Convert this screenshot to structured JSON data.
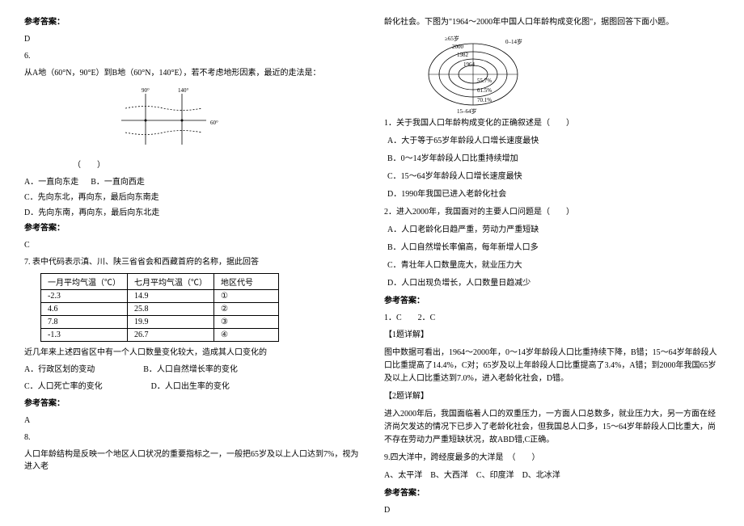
{
  "left": {
    "ans_label_1": "参考答案：",
    "ans_1": "D",
    "q6_num": "6.",
    "q6_text": "从A地（60°N，90°E）到B地（60°N，140°E），若不考虑地形因素，最近的走法是：",
    "q6_paren": "（　　）",
    "q6_optA": "A．一直向东走",
    "q6_optB": "B．一直向西走",
    "q6_optC": "C．先向东北，再向东，最后向东南走",
    "q6_optD": "D．先向东南，再向东，最后向东北走",
    "ans_label_2": "参考答案：",
    "ans_2": "C",
    "q7_text": "7. 表中代码表示滇、川、陕三省省会和西藏首府的名称，据此回答",
    "table": {
      "h1": "一月平均气温（℃）",
      "h2": "七月平均气温（℃）",
      "h3": "地区代号",
      "r1c1": "-2.3",
      "r1c2": "14.9",
      "r1c3": "①",
      "r2c1": "4.6",
      "r2c2": "25.8",
      "r2c3": "②",
      "r3c1": "7.8",
      "r3c2": "19.9",
      "r3c3": "③",
      "r4c1": "-1.3",
      "r4c2": "26.7",
      "r4c3": "④"
    },
    "q7_sub": "近几年来上述四省区中有一个人口数量变化较大，造成其人口变化的",
    "q7_optA": "A．行政区划的变动",
    "q7_optB": "B．人口自然增长率的变化",
    "q7_optC": "C．人口死亡率的变化",
    "q7_optD": "D．人口出生率的变化",
    "ans_label_3": "参考答案：",
    "ans_3": "A",
    "q8_num": "8.",
    "q8_text": "人口年龄结构是反映一个地区人口状况的重要指标之一，一般把65岁及以上人口达到7%，视为进入老"
  },
  "right": {
    "q8_cont": "龄化社会。下图为\"1964～2000年中国人口年龄构成变化图\"，据图回答下面小题。",
    "q8_1": "1．关于我国人口年龄构成变化的正确叙述是（　　）",
    "q8_1A": "A．大于等于65岁年龄段人口增长速度最快",
    "q8_1B": "B．0～14岁年龄段人口比重持续增加",
    "q8_1C": "C．15～64岁年龄段人口增长速度最快",
    "q8_1D": "D．1990年我国已进入老龄化社会",
    "q8_2": "2．进入2000年，我国面对的主要人口问题是（　　）",
    "q8_2A": "A．人口老龄化日趋严重，劳动力严重短缺",
    "q8_2B": "B．人口自然增长率偏高，每年新增人口多",
    "q8_2C": "C．青壮年人口数量庞大，就业压力大",
    "q8_2D": "D．人口出现负增长，人口数量日趋减少",
    "ans_label_4": "参考答案：",
    "ans_4": "1．C　　2．C",
    "expl1_h": "【1题详解】",
    "expl1": "图中数据可看出，1964～2000年，0～14岁年龄段人口比重持续下降，B错；15～64岁年龄段人口比重提高了14.4%，C对；65岁及以上年龄段人口比重提高了3.4%，A错；到2000年我国65岁及以上人口比重达到7.0%，进入老龄化社会，D错。",
    "expl2_h": "【2题详解】",
    "expl2": "进入2000年后，我国面临着人口的双重压力，一方面人口总数多，就业压力大，另一方面在经济尚欠发达的情况下已步入了老龄化社会，但我国总人口多，15～64岁年龄段人口比重大，尚不存在劳动力严重短缺状况，故ABD错,C正确。",
    "q9_text": "9.四大洋中，跨经度最多的大洋是　（　　）",
    "q9_optA": "A、太平洋",
    "q9_optB": "B、大西洋",
    "q9_optC": "C、印度洋",
    "q9_optD": "D、北冰洋",
    "ans_label_5": "参考答案：",
    "ans_5": "D"
  },
  "svg1": {
    "l90": "90°",
    "l140": "140°",
    "l60": "60°"
  },
  "svg2": {
    "topLabel": "≥65岁",
    "rightLabel": "0–14岁",
    "bottomLabel": "15–64岁"
  }
}
